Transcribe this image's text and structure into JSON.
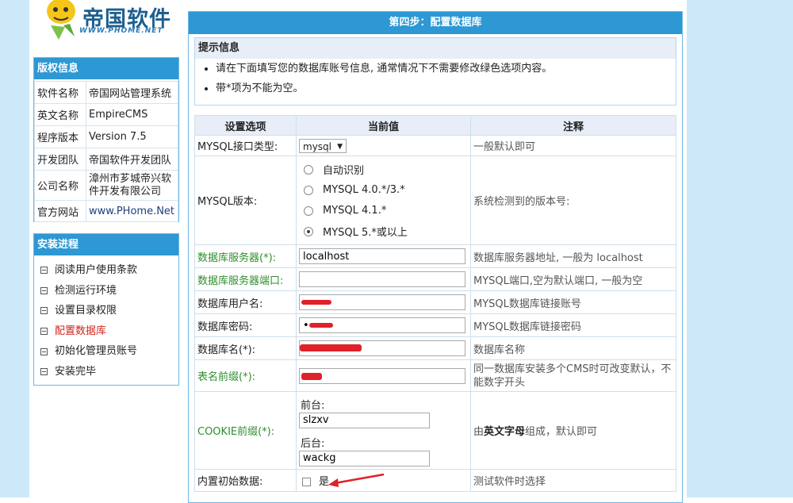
{
  "logo": {
    "text": "帝国软件",
    "url_text": "WWW.PHOME.NET"
  },
  "copyright": {
    "title": "版权信息",
    "rows": [
      {
        "k": "软件名称",
        "v": "帝国网站管理系统"
      },
      {
        "k": "英文名称",
        "v": "EmpireCMS"
      },
      {
        "k": "程序版本",
        "v": "Version 7.5"
      },
      {
        "k": "开发团队",
        "v": "帝国软件开发团队"
      },
      {
        "k": "公司名称",
        "v": "漳州市芗城帝兴软件开发有限公司"
      },
      {
        "k": "官方网站",
        "v": "www.PHome.Net"
      }
    ]
  },
  "progress": {
    "title": "安装进程",
    "steps": [
      "阅读用户使用条款",
      "检测运行环境",
      "设置目录权限",
      "配置数据库",
      "初始化管理员账号",
      "安装完毕"
    ],
    "current_index": 3
  },
  "main": {
    "title": "第四步：配置数据库",
    "notice": {
      "title": "提示信息",
      "items": [
        "请在下面填写您的数据库账号信息, 通常情况下不需要修改绿色选项内容。",
        "带*项为不能为空。"
      ]
    },
    "headers": [
      "设置选项",
      "当前值",
      "注释"
    ],
    "mysql_type": {
      "label": "MYSQL接口类型:",
      "value": "mysql",
      "note": "一般默认即可"
    },
    "mysql_version": {
      "label": "MYSQL版本:",
      "options": [
        "自动识别",
        "MYSQL 4.0.*/3.*",
        "MYSQL 4.1.*",
        "MYSQL 5.*或以上"
      ],
      "selected": 3,
      "note": "系统检测到的版本号:"
    },
    "db_server": {
      "label": "数据库服务器(*):",
      "value": "localhost",
      "note": "数据库服务器地址, 一般为 localhost"
    },
    "db_port": {
      "label": "数据库服务器端口:",
      "value": "",
      "note": "MYSQL端口,空为默认端口, 一般为空"
    },
    "db_user": {
      "label": "数据库用户名:",
      "note": "MYSQL数据库链接账号"
    },
    "db_pass": {
      "label": "数据库密码:",
      "value": "••",
      "note": "MYSQL数据库链接密码"
    },
    "db_name": {
      "label": "数据库名(*):",
      "value": "",
      "note": "数据库名称"
    },
    "table_prefix": {
      "label": "表名前缀(*):",
      "note": "同一数据库安装多个CMS时可改变默认，不能数字开头"
    },
    "cookie": {
      "label": "COOKIE前缀(*):",
      "front_label": "前台:",
      "front_value": "slzxv",
      "back_label": "后台:",
      "back_value": "wackg",
      "note_bold": "英文字母",
      "note_pre": "由",
      "note_post": "组成，默认即可"
    },
    "init_data": {
      "label": "内置初始数据:",
      "checkbox_label": "是",
      "note": "测试软件时选择"
    }
  },
  "colors": {
    "header_blue": "#2d98d3",
    "page_bg": "#cde9f8",
    "green_label": "#2d8e2d",
    "current_step": "#d0261d",
    "redaction": "#e0202a"
  }
}
